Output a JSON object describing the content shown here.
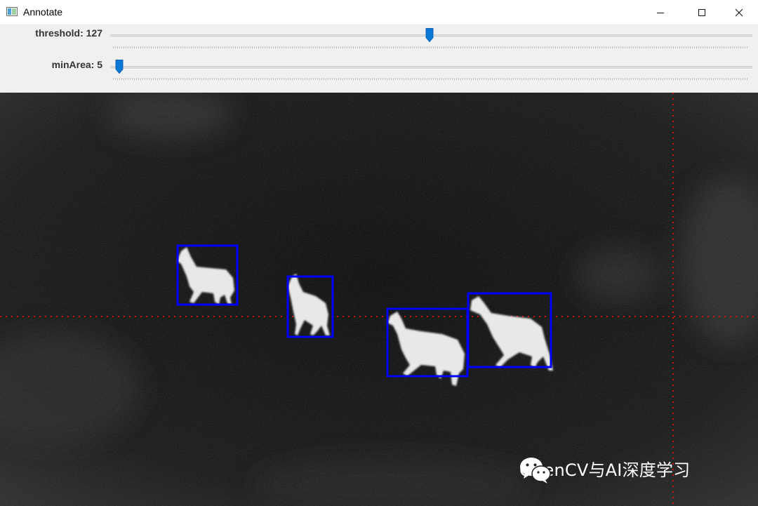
{
  "window": {
    "title": "Annotate",
    "icon": "opencv-window-icon"
  },
  "controls": {
    "threshold": {
      "label": "threshold: 127",
      "value": 127,
      "max": 255
    },
    "minArea": {
      "label": "minArea: 5",
      "value": 5,
      "max": 255
    }
  },
  "image": {
    "description_icons": [
      "deer-1",
      "deer-2",
      "deer-3",
      "deer-4"
    ],
    "box_color": "#0000ff",
    "crosshair_color": "#d01010",
    "detections": 4
  },
  "watermark": {
    "text": "OpenCV与AI深度学习",
    "icon": "wechat-icon"
  }
}
